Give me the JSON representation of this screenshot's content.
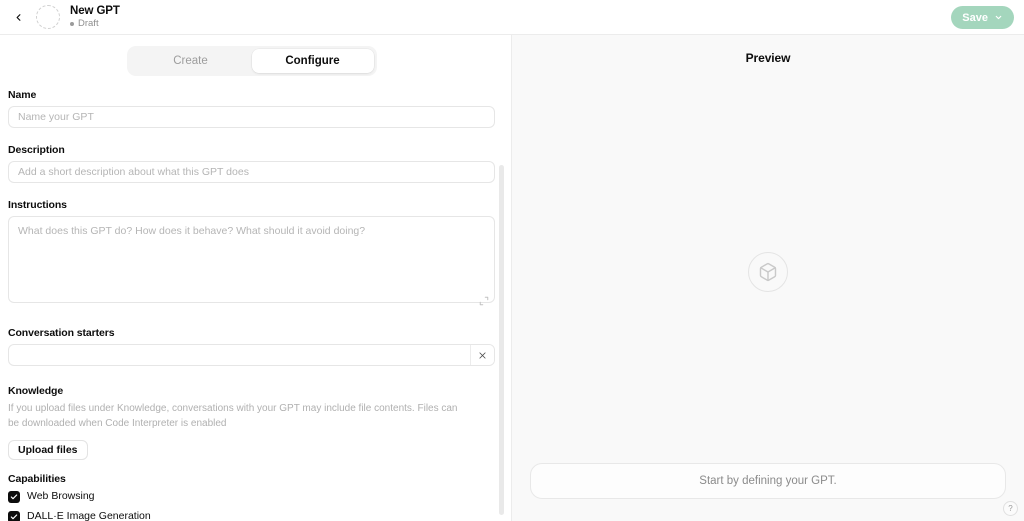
{
  "header": {
    "back_icon": "chevron-left-icon",
    "avatar_icon": "avatar-placeholder",
    "title": "New GPT",
    "status": "Draft",
    "save_label": "Save",
    "save_chevron_icon": "chevron-down-icon",
    "save_color": "#a4d6bd"
  },
  "tabs": [
    {
      "label": "Create",
      "active": false
    },
    {
      "label": "Configure",
      "active": true
    }
  ],
  "form": {
    "name": {
      "label": "Name",
      "value": "",
      "placeholder": "Name your GPT"
    },
    "description": {
      "label": "Description",
      "value": "",
      "placeholder": "Add a short description about what this GPT does"
    },
    "instructions": {
      "label": "Instructions",
      "value": "",
      "placeholder": "What does this GPT do? How does it behave? What should it avoid doing?",
      "expand_icon": "expand-corner-icon"
    },
    "conversation_starters": {
      "label": "Conversation starters",
      "value": "",
      "placeholder": "",
      "remove_icon": "close-icon"
    },
    "knowledge": {
      "label": "Knowledge",
      "description": "If you upload files under Knowledge, conversations with your GPT may include file contents. Files can be downloaded when Code Interpreter is enabled",
      "upload_label": "Upload files"
    },
    "capabilities": {
      "label": "Capabilities",
      "items": [
        {
          "label": "Web Browsing",
          "checked": true
        },
        {
          "label": "DALL·E Image Generation",
          "checked": true
        }
      ]
    }
  },
  "preview": {
    "title": "Preview",
    "empty_icon": "cube-icon",
    "composer_placeholder": "Start by defining your GPT.",
    "help_label": "?"
  }
}
